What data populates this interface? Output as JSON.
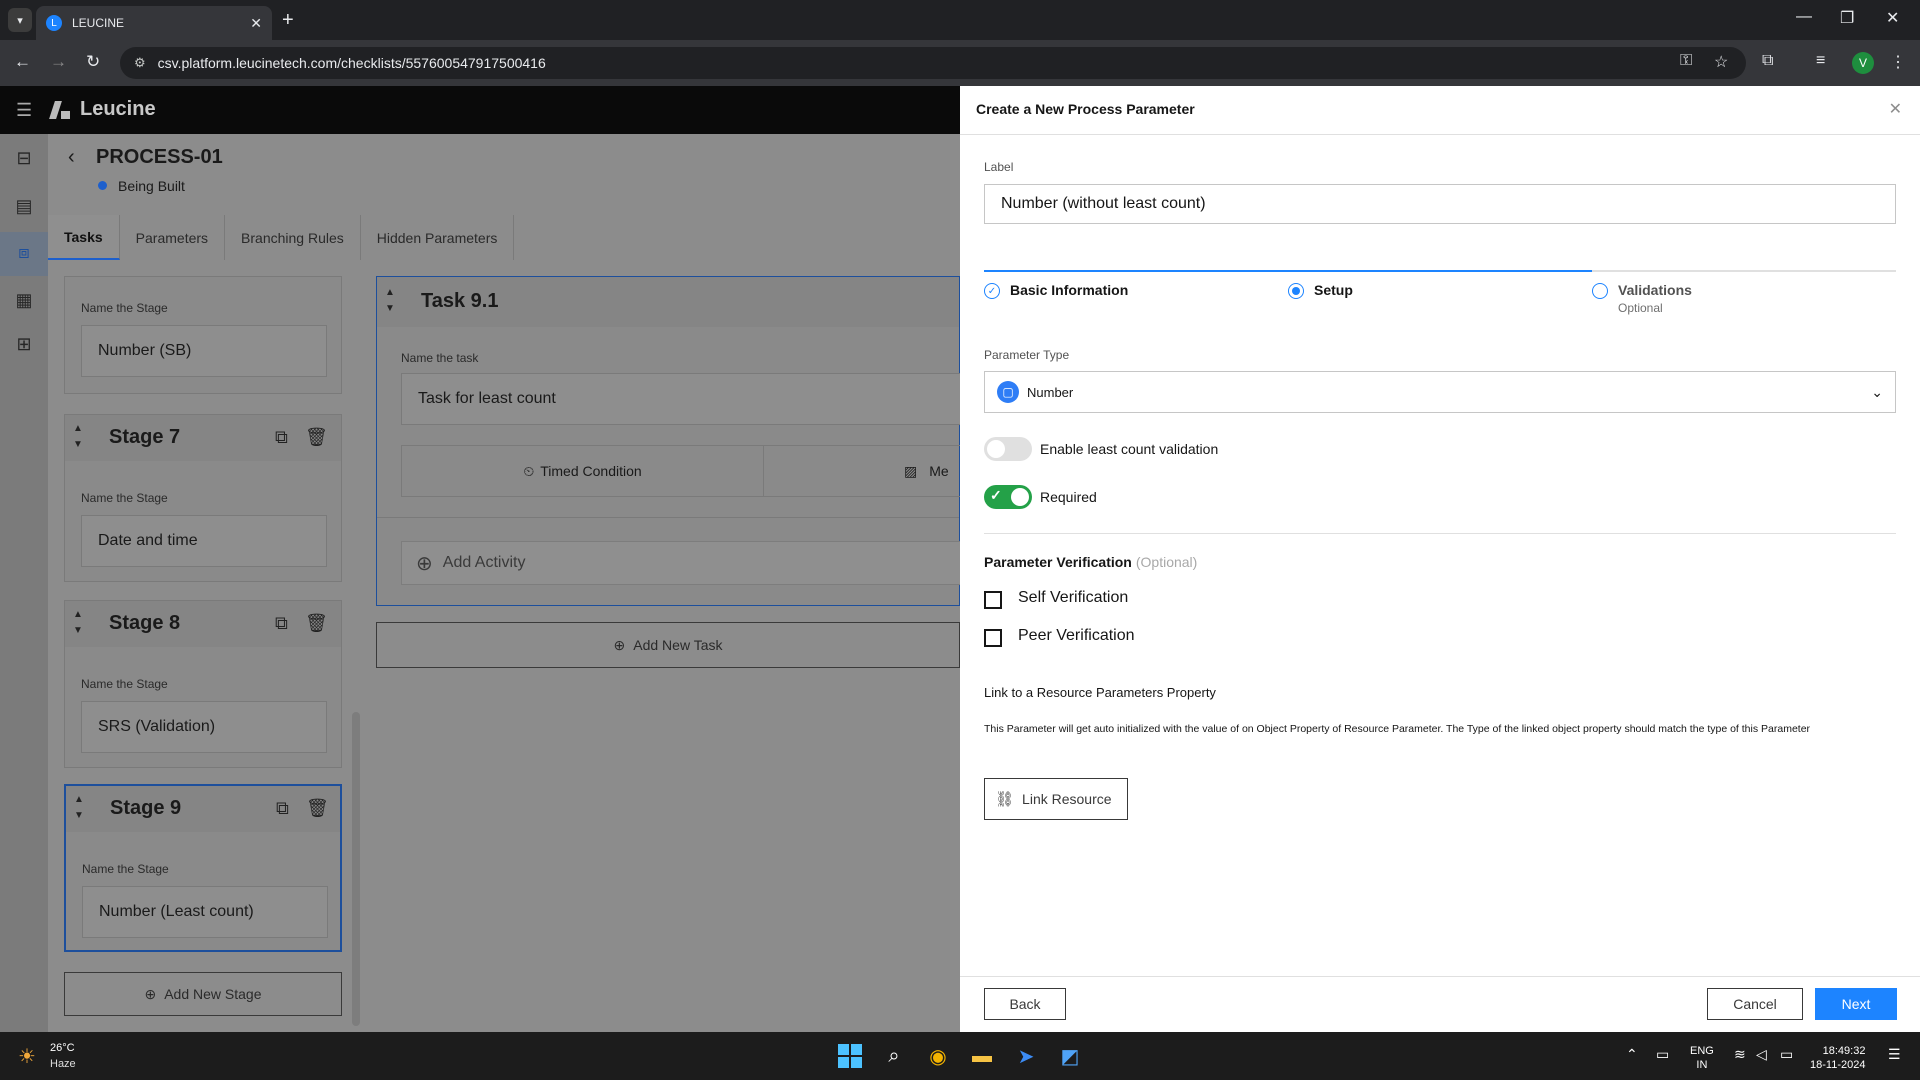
{
  "browser": {
    "tab_title": "LEUCINE",
    "url": "csv.platform.leucinetech.com/checklists/557600547917500416",
    "profile_initial": "V"
  },
  "app": {
    "brand": "Leucine",
    "process_title": "PROCESS-01",
    "status": "Being Built",
    "tabs": [
      "Tasks",
      "Parameters",
      "Branching Rules",
      "Hidden Parameters"
    ]
  },
  "stages": [
    {
      "title": "",
      "field_label": "Name the Stage",
      "value": "Number (SB)"
    },
    {
      "title": "Stage 7",
      "field_label": "Name the Stage",
      "value": "Date and time"
    },
    {
      "title": "Stage 8",
      "field_label": "Name the Stage",
      "value": "SRS (Validation)"
    },
    {
      "title": "Stage 9",
      "field_label": "Name the Stage",
      "value": "Number (Least count)"
    }
  ],
  "add_stage_label": "Add New Stage",
  "task": {
    "title": "Task 9.1",
    "field_label": "Name the task",
    "value": "Task for least count",
    "timed_condition": "Timed Condition",
    "media_partial": "Me",
    "add_activity": "Add Activity",
    "add_task": "Add New Task"
  },
  "drawer": {
    "title": "Create a New Process Parameter",
    "label_caption": "Label",
    "label_value": "Number (without least count)",
    "steps": [
      {
        "label": "Basic Information",
        "state": "done"
      },
      {
        "label": "Setup",
        "state": "current"
      },
      {
        "label": "Validations",
        "sub": "Optional",
        "state": "todo"
      }
    ],
    "param_type_caption": "Parameter Type",
    "param_type_value": "Number",
    "least_count_label": "Enable least count validation",
    "least_count_on": false,
    "required_label": "Required",
    "required_on": true,
    "verification_title": "Parameter Verification",
    "verification_optional": "(Optional)",
    "self_verification": "Self Verification",
    "peer_verification": "Peer Verification",
    "link_title": "Link to a Resource Parameters Property",
    "link_desc": "This Parameter will get auto initialized with the value of on Object Property of Resource Parameter. The Type of the linked object property should match the type of this Parameter",
    "link_button": "Link Resource",
    "back": "Back",
    "cancel": "Cancel",
    "next": "Next"
  },
  "taskbar": {
    "temp": "26°C",
    "condition": "Haze",
    "lang_top": "ENG",
    "lang_bottom": "IN",
    "time": "18:49:32",
    "date": "18-11-2024"
  },
  "colors": {
    "accent": "#1d84ff",
    "toggle_on": "#24a148"
  }
}
